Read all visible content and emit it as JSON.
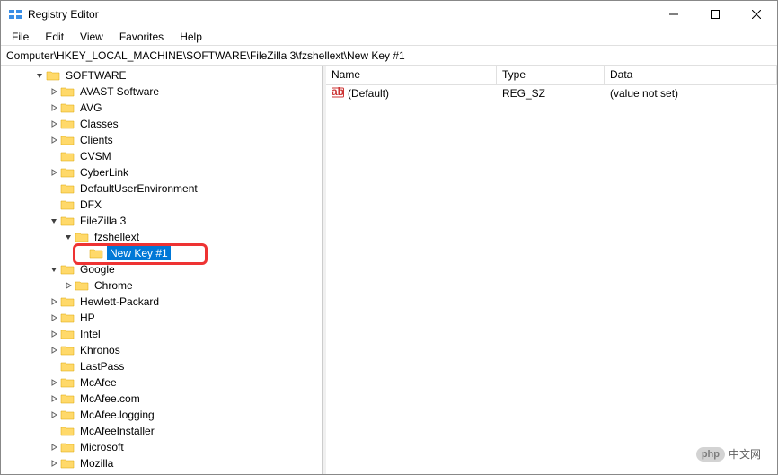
{
  "window": {
    "title": "Registry Editor"
  },
  "menu": {
    "file": "File",
    "edit": "Edit",
    "view": "View",
    "favorites": "Favorites",
    "help": "Help"
  },
  "address": "Computer\\HKEY_LOCAL_MACHINE\\SOFTWARE\\FileZilla 3\\fzshellext\\New Key #1",
  "tree": {
    "root": "SOFTWARE",
    "items": [
      "AVAST Software",
      "AVG",
      "Classes",
      "Clients",
      "CVSM",
      "CyberLink",
      "DefaultUserEnvironment",
      "DFX"
    ],
    "filezilla": {
      "label": "FileZilla 3",
      "sub": "fzshellext",
      "newkey": "New Key #1"
    },
    "google": {
      "label": "Google",
      "sub": "Chrome"
    },
    "rest": [
      "Hewlett-Packard",
      "HP",
      "Intel",
      "Khronos",
      "LastPass",
      "McAfee",
      "McAfee.com",
      "McAfee.logging",
      "McAfeeInstaller",
      "Microsoft",
      "Mozilla"
    ]
  },
  "values": {
    "cols": {
      "name": "Name",
      "type": "Type",
      "data": "Data"
    },
    "rows": [
      {
        "name": "(Default)",
        "type": "REG_SZ",
        "data": "(value not set)"
      }
    ]
  },
  "watermark": {
    "bubble": "php",
    "text": "中文网"
  }
}
